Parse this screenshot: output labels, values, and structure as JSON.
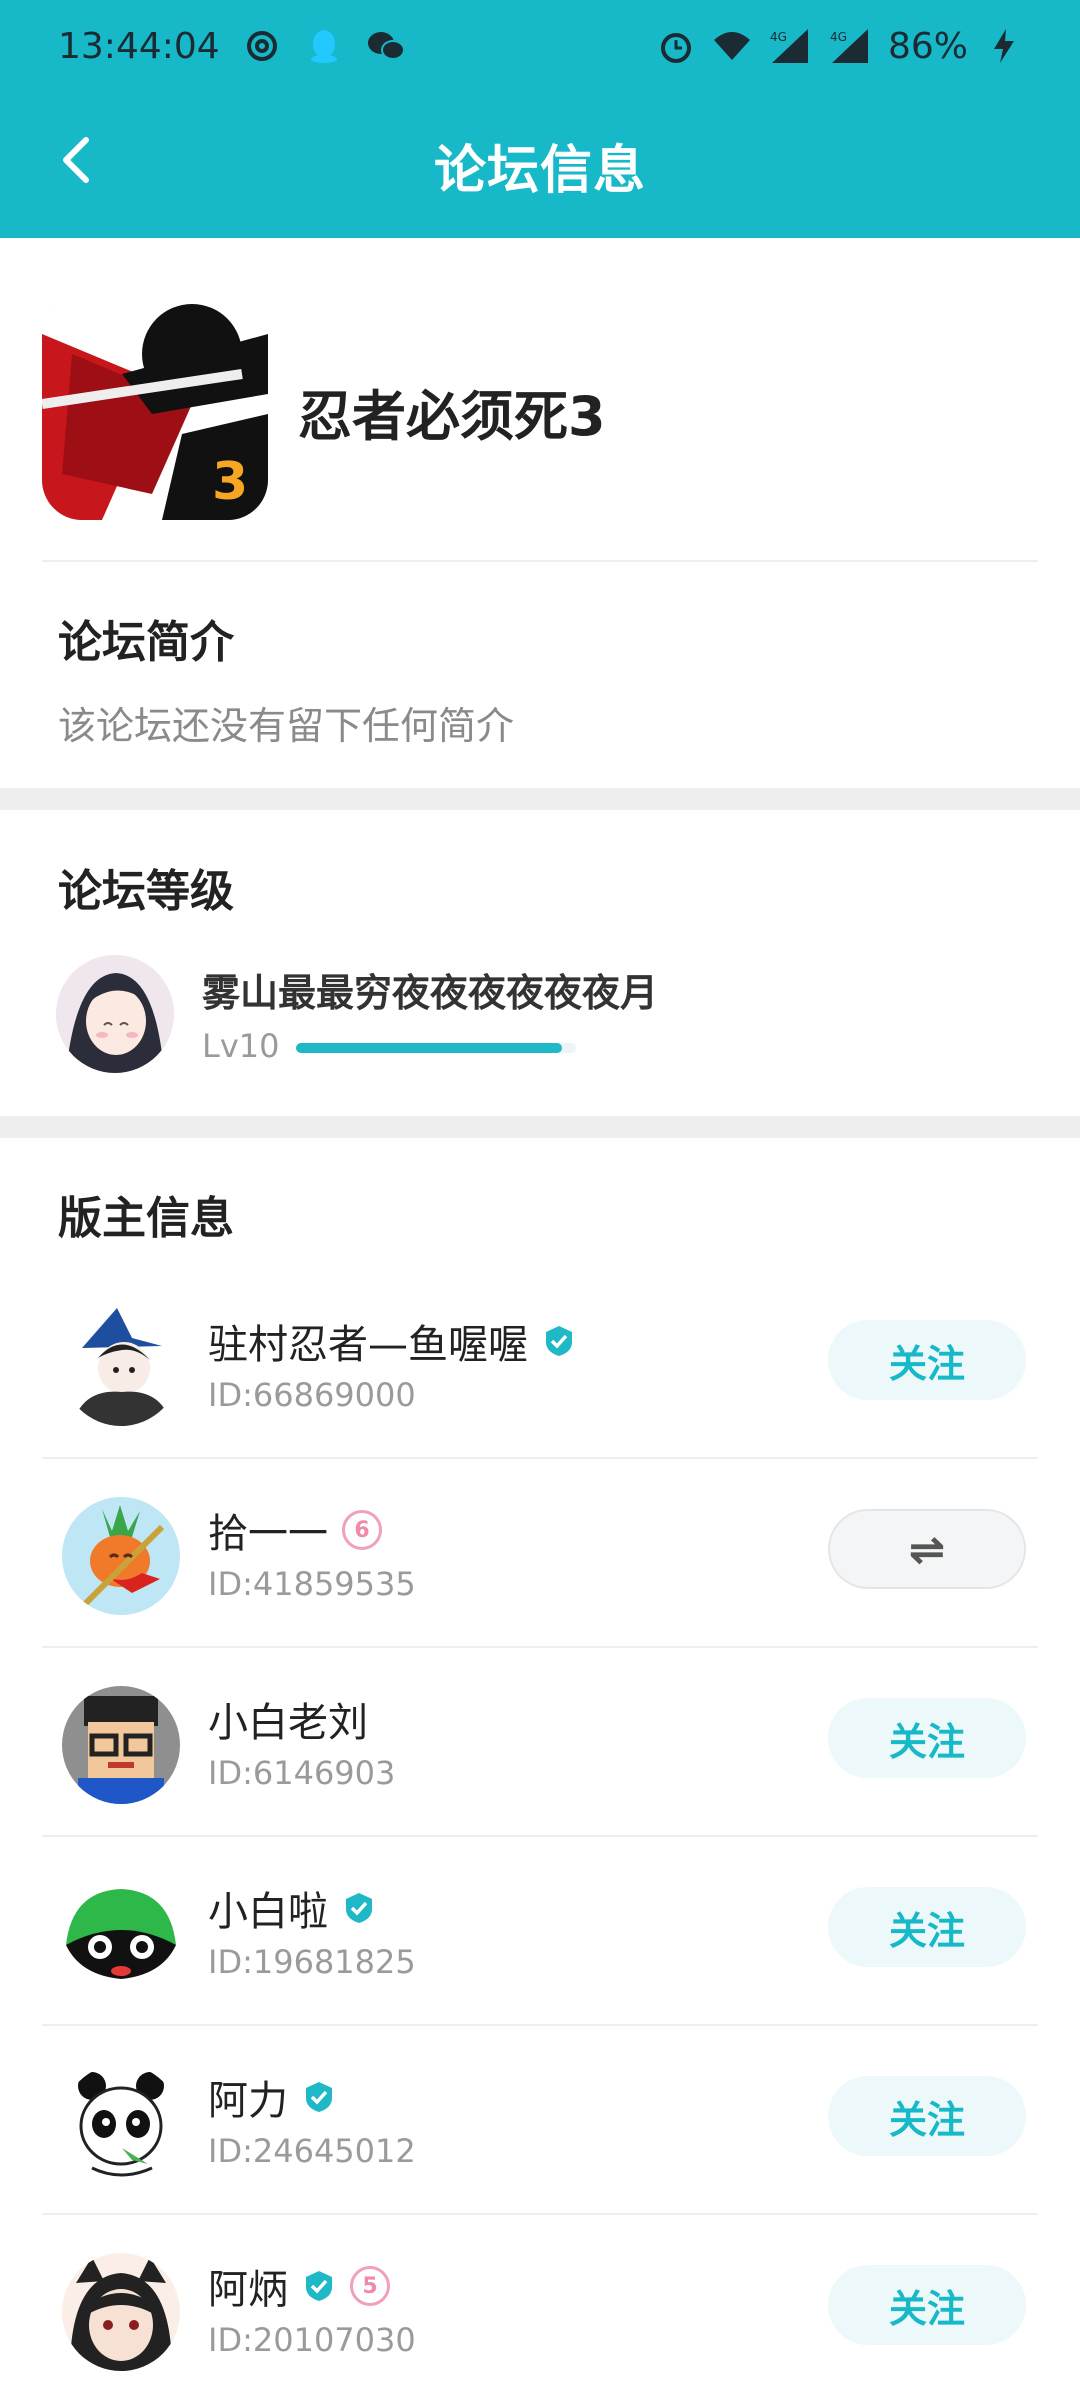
{
  "status_bar": {
    "time": "13:44:04",
    "battery": "86%",
    "network_1": "4G",
    "network_2": "4G"
  },
  "header": {
    "title": "论坛信息"
  },
  "forum": {
    "name": "忍者必须死3",
    "icon_badge": "3"
  },
  "intro": {
    "title": "论坛简介",
    "text": "该论坛还没有留下任何简介"
  },
  "level": {
    "title": "论坛等级",
    "user_name": "雾山最最穷夜夜夜夜夜夜月",
    "level_label": "Lv10",
    "progress_fraction": 0.95
  },
  "moderators": {
    "title": "版主信息",
    "items": [
      {
        "name": "驻村忍者—鱼喔喔",
        "id": "ID:66869000",
        "verified": true,
        "level_badge": "",
        "action": "关注",
        "action_type": "follow"
      },
      {
        "name": "拾一一",
        "id": "ID:41859535",
        "verified": false,
        "level_badge": "6",
        "action": "⇌",
        "action_type": "mutual"
      },
      {
        "name": "小白老刘",
        "id": "ID:6146903",
        "verified": false,
        "level_badge": "",
        "action": "关注",
        "action_type": "follow"
      },
      {
        "name": "小白啦",
        "id": "ID:19681825",
        "verified": true,
        "level_badge": "",
        "action": "关注",
        "action_type": "follow"
      },
      {
        "name": "阿力",
        "id": "ID:24645012",
        "verified": true,
        "level_badge": "",
        "action": "关注",
        "action_type": "follow"
      },
      {
        "name": "阿炳",
        "id": "ID:20107030",
        "verified": true,
        "level_badge": "5",
        "action": "关注",
        "action_type": "follow"
      }
    ]
  },
  "colors": {
    "accent": "#17b8c8",
    "follow_bg": "#ecf8f9"
  }
}
